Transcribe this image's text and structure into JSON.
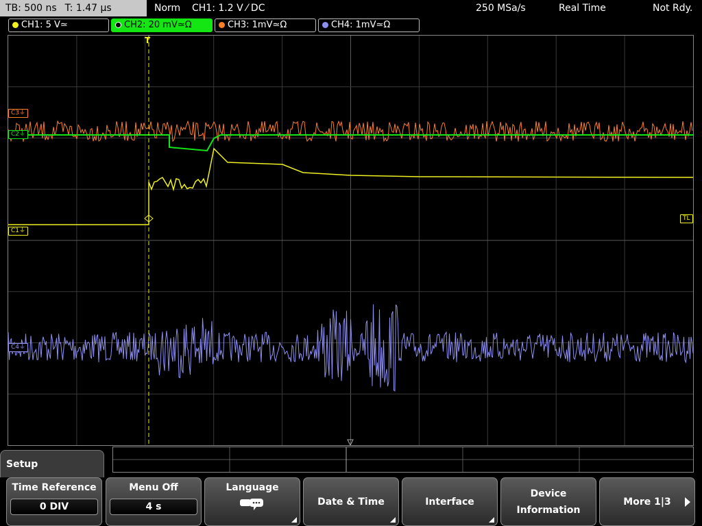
{
  "status": {
    "timebase": "TB: 500 ns",
    "trigger_time": "T: 1.47 µs",
    "mode": "Norm",
    "trigger_info": "CH1: 1.2 V ⁄ DC",
    "sample_rate": "250 MSa/s",
    "acq_mode": "Real Time",
    "state": "Not Rdy."
  },
  "channels": [
    {
      "label": "CH1: 5 V≃",
      "color": "#f0f020"
    },
    {
      "label": "CH2: 20 mV≃Ω",
      "color": "#14e614"
    },
    {
      "label": "CH3: 1mV≃Ω",
      "color": "#ff7f27"
    },
    {
      "label": "CH4: 1mV≃Ω",
      "color": "#8f8ff0"
    }
  ],
  "markers": {
    "c3": "C3⏚",
    "c2": "C2⏚",
    "c1": "C1⏚",
    "c4": "C4⏚",
    "tl": "TL",
    "trigger": "T"
  },
  "menu": {
    "title": "Setup",
    "keys": [
      {
        "label": "Time Reference",
        "value": "0 DIV"
      },
      {
        "label": "Menu Off",
        "value": "4 s"
      },
      {
        "label": "Language",
        "icon": "speech-bubbles-icon"
      },
      {
        "label": "Date & Time"
      },
      {
        "label": "Interface"
      },
      {
        "label": "Device Information"
      },
      {
        "label": "More 1|3",
        "icon": "arrow-right-icon"
      }
    ]
  }
}
